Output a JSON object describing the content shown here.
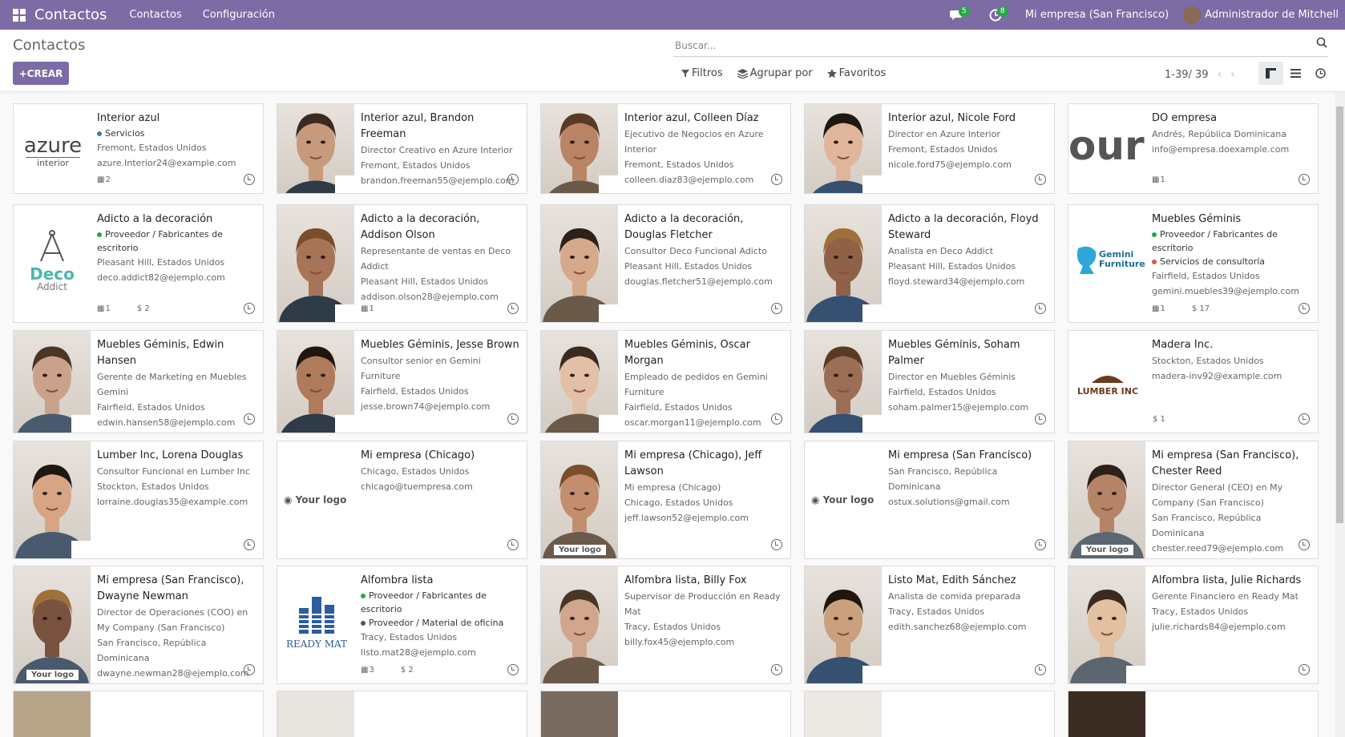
{
  "app": {
    "title": "Contactos",
    "menu": [
      "Contactos",
      "Configuración"
    ]
  },
  "topbar": {
    "messages_badge": "5",
    "activity_badge": "8",
    "company": "Mi empresa (San Francisco)",
    "user": "Administrador de Mitchell"
  },
  "control": {
    "breadcrumb": "Contactos",
    "create_label": "CREAR",
    "search_placeholder": "Buscar...",
    "filters_label": "Filtros",
    "groupby_label": "Agrupar por",
    "favorites_label": "Favoritos",
    "pager": "1-39/ 39"
  },
  "cards": [
    {
      "name": "Interior azul",
      "tags": [
        {
          "label": "Servicios",
          "color": "#3a7ca5"
        }
      ],
      "lines": [
        "Fremont, Estados Unidos",
        "azure.Interior24@example.com"
      ],
      "footer": [
        "2"
      ],
      "image": "azure-logo"
    },
    {
      "name": "Interior azul, Brandon Freeman",
      "lines": [
        "Director Creativo en Azure Interior",
        "Fremont, Estados Unidos",
        "brandon.freeman55@ejemplo.com"
      ],
      "image": "photo"
    },
    {
      "name": "Interior azul, Colleen Díaz",
      "lines": [
        "Ejecutivo de Negocios en Azure Interior",
        "Fremont, Estados Unidos",
        "colleen.diaz83@ejemplo.com"
      ],
      "image": "photo"
    },
    {
      "name": "Interior azul, Nicole Ford",
      "lines": [
        "Director en Azure Interior",
        "Fremont, Estados Unidos",
        "nicole.ford75@ejemplo.com"
      ],
      "image": "photo"
    },
    {
      "name": "DO empresa",
      "lines": [
        "Andrés, República Dominicana",
        "info@empresa.doexample.com"
      ],
      "footer": [
        "1"
      ],
      "image": "your-logo-crop"
    },
    {
      "name": "Adicto a la decoración",
      "tags": [
        {
          "label": "Proveedor / Fabricantes de escritorio",
          "color": "#28a745"
        }
      ],
      "lines": [
        "Pleasant Hill, Estados Unidos",
        "deco.addict82@ejemplo.com"
      ],
      "footer": [
        "1",
        "$ 2"
      ],
      "image": "deco-logo"
    },
    {
      "name": "Adicto a la decoración, Addison Olson",
      "lines": [
        "Representante de ventas en Deco Addict",
        "Pleasant Hill, Estados Unidos",
        "addison.olson28@ejemplo.com"
      ],
      "footer": [
        "1"
      ],
      "image": "photo"
    },
    {
      "name": "Adicto a la decoración, Douglas Fletcher",
      "lines": [
        "Consultor Deco Funcional Adicto",
        "Pleasant Hill, Estados Unidos",
        "douglas.fletcher51@ejemplo.com"
      ],
      "image": "photo"
    },
    {
      "name": "Adicto a la decoración, Floyd Steward",
      "lines": [
        "Analista en Deco Addict",
        "Pleasant Hill, Estados Unidos",
        "floyd.steward34@ejemplo.com"
      ],
      "image": "photo"
    },
    {
      "name": "Muebles Géminis",
      "tags": [
        {
          "label": "Proveedor / Fabricantes de escritorio",
          "color": "#28a745"
        },
        {
          "label": "Servicios de consultoría",
          "color": "#d9534f"
        }
      ],
      "lines": [
        "Fairfield, Estados Unidos",
        "gemini.muebles39@ejemplo.com"
      ],
      "footer": [
        "1",
        "$ 17"
      ],
      "image": "gemini-logo"
    },
    {
      "name": "Muebles Géminis, Edwin Hansen",
      "lines": [
        "Gerente de Marketing en Muebles Gemini",
        "Fairfield, Estados Unidos",
        "edwin.hansen58@ejemplo.com"
      ],
      "image": "photo"
    },
    {
      "name": "Muebles Géminis, Jesse Brown",
      "lines": [
        "Consultor senior en Gemini Furniture",
        "Fairfield, Estados Unidos",
        "jesse.brown74@ejemplo.com"
      ],
      "image": "photo"
    },
    {
      "name": "Muebles Géminis, Oscar Morgan",
      "lines": [
        "Empleado de pedidos en Gemini Furniture",
        "Fairfield, Estados Unidos",
        "oscar.morgan11@ejemplo.com"
      ],
      "image": "photo"
    },
    {
      "name": "Muebles Géminis, Soham Palmer",
      "lines": [
        "Director en Muebles Géminis",
        "Fairfield, Estados Unidos",
        "soham.palmer15@ejemplo.com"
      ],
      "image": "photo"
    },
    {
      "name": "Madera Inc.",
      "lines": [
        "Stockton, Estados Unidos",
        "madera-inv92@example.com"
      ],
      "footer": [
        "$ 1"
      ],
      "image": "lumber-logo"
    },
    {
      "name": "Lumber Inc, Lorena Douglas",
      "lines": [
        "Consultor Funcional en Lumber Inc",
        "Stockton, Estados Unidos",
        "lorraine.douglas35@example.com"
      ],
      "image": "photo"
    },
    {
      "name": "Mi empresa (Chicago)",
      "lines": [
        "Chicago, Estados Unidos",
        "chicago@tuempresa.com"
      ],
      "image": "your-logo"
    },
    {
      "name": "Mi empresa (Chicago), Jeff Lawson",
      "lines": [
        "Mi empresa (Chicago)",
        "Chicago, Estados Unidos",
        "jeff.lawson52@ejemplo.com"
      ],
      "image": "photo"
    },
    {
      "name": "Mi empresa (San Francisco)",
      "lines": [
        "San Francisco, República Dominicana",
        "ostux.solutions@gmail.com"
      ],
      "image": "your-logo"
    },
    {
      "name": "Mi empresa (San Francisco), Chester Reed",
      "lines": [
        "Director General (CEO) en My Company (San Francisco)",
        "San Francisco, República Dominicana",
        "chester.reed79@ejemplo.com"
      ],
      "image": "photo"
    },
    {
      "name": "Mi empresa (San Francisco), Dwayne Newman",
      "lines": [
        "Director de Operaciones (COO) en My Company (San Francisco)",
        "San Francisco, República Dominicana",
        "dwayne.newman28@ejemplo.com"
      ],
      "image": "photo"
    },
    {
      "name": "Alfombra lista",
      "tags": [
        {
          "label": "Proveedor / Fabricantes de escritorio",
          "color": "#28a745"
        },
        {
          "label": "Proveedor / Material de oficina",
          "color": "#555555"
        }
      ],
      "lines": [
        "Tracy, Estados Unidos",
        "listo.mat28@ejemplo.com"
      ],
      "footer": [
        "3",
        "$ 2"
      ],
      "image": "readymat-logo"
    },
    {
      "name": "Alfombra lista, Billy Fox",
      "lines": [
        "Supervisor de Producción en Ready Mat",
        "Tracy, Estados Unidos",
        "billy.fox45@ejemplo.com"
      ],
      "image": "photo"
    },
    {
      "name": "Listo Mat, Edith Sánchez",
      "lines": [
        "Analista de comida preparada",
        "Tracy, Estados Unidos",
        "edith.sanchez68@ejemplo.com"
      ],
      "image": "photo"
    },
    {
      "name": "Alfombra lista, Julie Richards",
      "lines": [
        "Gerente Financiero en Ready Mat",
        "Tracy, Estados Unidos",
        "julie.richards84@ejemplo.com"
      ],
      "image": "photo"
    }
  ],
  "logos": {
    "azure": "azure",
    "azure_sub": "interior",
    "deco": "Deco",
    "deco_sub": "Addict",
    "gemini": "Gemini",
    "gemini_sub": "Furniture",
    "lumber": "LUMBER INC",
    "readymat": "READY MAT",
    "yourlogo": "Your logo",
    "do_crop": "our"
  }
}
